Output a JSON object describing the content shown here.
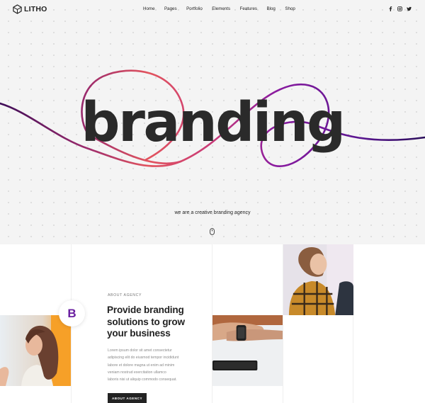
{
  "brand": {
    "name": "LITHO",
    "logo_icon": "hexagon-cube-logo"
  },
  "nav": {
    "items": [
      "Home",
      "Pages",
      "Portfolio",
      "Elements",
      "Features",
      "Blog",
      "Shop"
    ]
  },
  "social": [
    {
      "icon": "facebook-icon"
    },
    {
      "icon": "instagram-icon"
    },
    {
      "icon": "twitter-icon"
    }
  ],
  "hero": {
    "headline": "branding",
    "tagline": "we are a creative branding agency",
    "scroll_icon": "mouse-scroll-icon",
    "curve_colors": [
      "#3d0d57",
      "#e2545e",
      "#8a1ba0",
      "#4b1380"
    ]
  },
  "about": {
    "badge_letter": "B",
    "eyebrow": "ABOUT AGENCY",
    "heading": "Provide branding solutions to grow your business",
    "body_lines": [
      "Lorem ipsum dolor sit amet consectetur",
      "adipiscing elit do eiusmod tempor incididunt",
      "labore et dolore magna ut enim ad minim",
      "veniam nostrud exercitation ullamco",
      "laboris nisi ut aliquip commodo consequat."
    ],
    "cta_label": "ABOUT AGENCY"
  },
  "colors": {
    "accent": "#6a1fa0",
    "dark": "#232323",
    "hero_bg": "#f4f4f4"
  }
}
